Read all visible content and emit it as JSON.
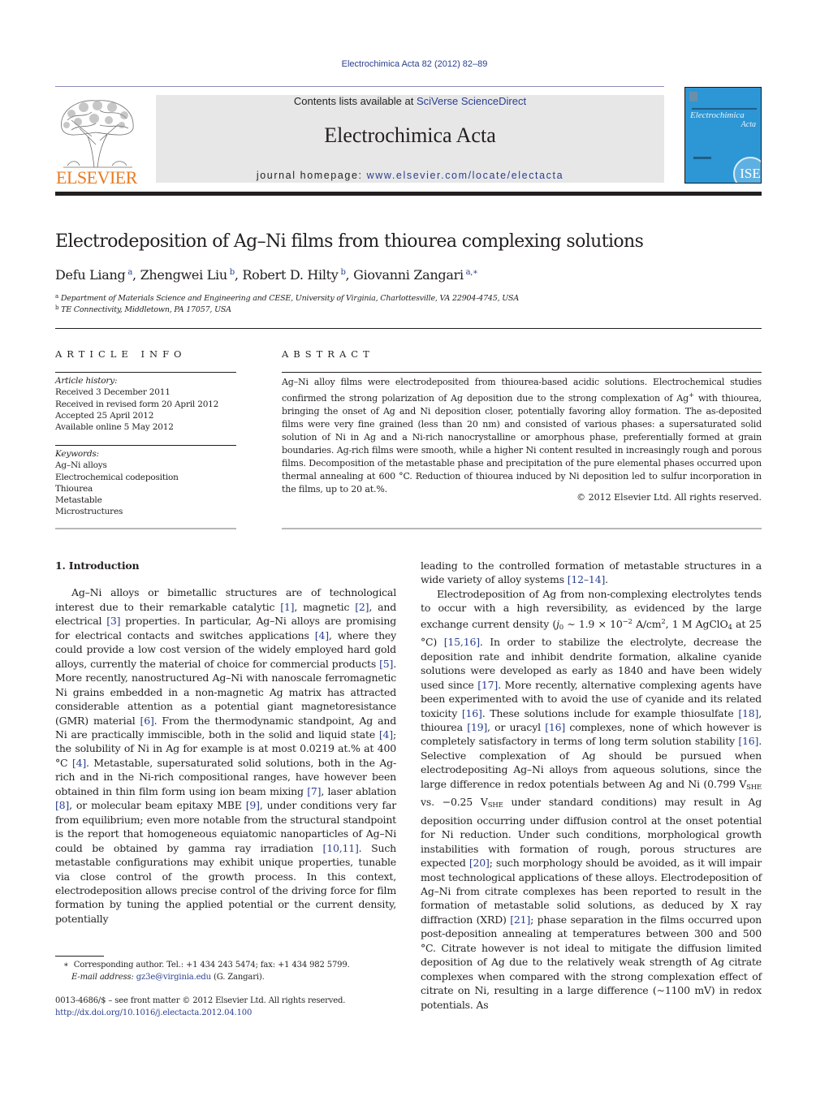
{
  "header": {
    "citation": "Electrochimica Acta 82 (2012) 82–89",
    "contents_prefix": "Contents lists available at ",
    "contents_link": "SciVerse ScienceDirect",
    "journal_name": "Electrochimica Acta",
    "homepage_prefix": "journal homepage: ",
    "homepage_link": "www.elsevier.com/locate/electacta",
    "publisher_logo_text": "ELSEVIER",
    "cover": {
      "title_line1": "Electrochimica",
      "title_line2": "Acta",
      "society_logo": "ISE",
      "background_color": "#2d96d4"
    }
  },
  "colors": {
    "link": "#2a3f8f",
    "elsevier_orange": "#e97a1f",
    "banner_grey": "#e7e7e8"
  },
  "article": {
    "title": "Electrodeposition of Ag–Ni films from thiourea complexing solutions",
    "authors": [
      {
        "name": "Defu Liang",
        "affil": "a",
        "sep": ", "
      },
      {
        "name": "Zhengwei Liu",
        "affil": "b",
        "sep": ", "
      },
      {
        "name": "Robert D. Hilty",
        "affil": "b",
        "sep": ", "
      },
      {
        "name": "Giovanni Zangari",
        "affil": "a,∗",
        "sep": ""
      }
    ],
    "affiliations": [
      {
        "key": "a",
        "text": "Department of Materials Science and Engineering and CESE, University of Virginia, Charlottesville, VA 22904-4745, USA"
      },
      {
        "key": "b",
        "text": "TE Connectivity, Middletown, PA 17057, USA"
      }
    ]
  },
  "article_info": {
    "heading": "ARTICLE INFO",
    "history_label": "Article history:",
    "history": [
      "Received 3 December 2011",
      "Received in revised form 20 April 2012",
      "Accepted 25 April 2012",
      "Available online 5 May 2012"
    ],
    "keywords_label": "Keywords:",
    "keywords": [
      "Ag–Ni alloys",
      "Electrochemical codeposition",
      "Thiourea",
      "Metastable",
      "Microstructures"
    ]
  },
  "abstract": {
    "heading": "ABSTRACT",
    "text_part1": "Ag–Ni alloy films were electrodeposited from thiourea-based acidic solutions. Electrochemical studies confirmed the strong polarization of Ag deposition due to the strong complexation of Ag",
    "text_sup": "+",
    "text_part2": " with thiourea, bringing the onset of Ag and Ni deposition closer, potentially favoring alloy formation. The as-deposited films were very fine grained (less than 20 nm) and consisted of various phases: a supersaturated solid solution of Ni in Ag and a Ni-rich nanocrystalline or amorphous phase, preferentially formed at grain boundaries. Ag-rich films were smooth, while a higher Ni content resulted in increasingly rough and porous films. Decomposition of the metastable phase and precipitation of the pure elemental phases occurred upon thermal annealing at 600 °C. Reduction of thiourea induced by Ni deposition led to sulfur incorporation in the films, up to 20 at.%.",
    "copyright": "© 2012 Elsevier Ltd. All rights reserved."
  },
  "introduction": {
    "heading": "1.  Introduction",
    "left_column": [
      {
        "t": "Ag–Ni alloys or bimetallic structures are of technological interest due to their remarkable catalytic "
      },
      {
        "r": "[1]"
      },
      {
        "t": ", magnetic "
      },
      {
        "r": "[2]"
      },
      {
        "t": ", and electrical "
      },
      {
        "r": "[3]"
      },
      {
        "t": " properties. In particular, Ag–Ni alloys are promising for electrical contacts and switches applications "
      },
      {
        "r": "[4]"
      },
      {
        "t": ", where they could provide a low cost version of the widely employed hard gold alloys, currently the material of choice for commercial products "
      },
      {
        "r": "[5]"
      },
      {
        "t": ". More recently, nanostructured Ag–Ni with nanoscale ferromagnetic Ni grains embedded in a non-magnetic Ag matrix has attracted considerable attention as a potential giant magnetoresistance (GMR) material "
      },
      {
        "r": "[6]"
      },
      {
        "t": ". From the thermodynamic standpoint, Ag and Ni are practically immiscible, both in the solid and liquid state "
      },
      {
        "r": "[4]"
      },
      {
        "t": "; the solubility of Ni in Ag for example is at most 0.0219 at.% at 400 °C "
      },
      {
        "r": "[4]"
      },
      {
        "t": ". Metastable, supersaturated solid solutions, both in the Ag-rich and in the Ni-rich compositional ranges, have however been obtained in thin film form using ion beam mixing "
      },
      {
        "r": "[7]"
      },
      {
        "t": ", laser ablation "
      },
      {
        "r": "[8]"
      },
      {
        "t": ", or molecular beam epitaxy MBE "
      },
      {
        "r": "[9]"
      },
      {
        "t": ", under conditions very far from equilibrium; even more notable from the structural standpoint is the report that homogeneous equiatomic nanoparticles of Ag–Ni could be obtained by gamma ray irradiation "
      },
      {
        "r": "[10,11]"
      },
      {
        "t": ". Such metastable configurations may exhibit unique properties, tunable via close control of the growth process. In this context, electrodeposition allows precise control of the driving force for film formation by tuning the applied potential or the current density, potentially"
      }
    ],
    "right_continuation": [
      {
        "t": "leading to the controlled formation of metastable structures in a wide variety of alloy systems "
      },
      {
        "r": "[12–14]"
      },
      {
        "t": "."
      }
    ],
    "right_paragraph": [
      {
        "t": "Electrodeposition of Ag from non-complexing electrolytes tends to occur with a high reversibility, as evidenced by the large exchange current density ("
      },
      {
        "i": "j"
      },
      {
        "sub": "0"
      },
      {
        "t": " ∼ 1.9 × 10"
      },
      {
        "sup": "−2"
      },
      {
        "t": " A/cm"
      },
      {
        "sup": "2"
      },
      {
        "t": ", 1 M AgClO"
      },
      {
        "sub": "4"
      },
      {
        "t": " at 25 °C) "
      },
      {
        "r": "[15,16]"
      },
      {
        "t": ". In order to stabilize the electrolyte, decrease the deposition rate and inhibit dendrite formation, alkaline cyanide solutions were developed as early as 1840 and have been widely used since "
      },
      {
        "r": "[17]"
      },
      {
        "t": ". More recently, alternative complexing agents have been experimented with to avoid the use of cyanide and its related toxicity "
      },
      {
        "r": "[16]"
      },
      {
        "t": ". These solutions include for example thiosulfate "
      },
      {
        "r": "[18]"
      },
      {
        "t": ", thiourea "
      },
      {
        "r": "[19]"
      },
      {
        "t": ", or uracyl "
      },
      {
        "r": "[16]"
      },
      {
        "t": " complexes, none of which however is completely satisfactory in terms of long term solution stability "
      },
      {
        "r": "[16]"
      },
      {
        "t": ". Selective complexation of Ag should be pursued when electrodepositing Ag–Ni alloys from aqueous solutions, since the large difference in redox potentials between Ag and Ni (0.799 V"
      },
      {
        "sub": "SHE"
      },
      {
        "t": " vs. −0.25 V"
      },
      {
        "sub": "SHE"
      },
      {
        "t": " under standard conditions) may result in Ag deposition occurring under diffusion control at the onset potential for Ni reduction. Under such conditions, morphological growth instabilities with formation of rough, porous structures are expected "
      },
      {
        "r": "[20]"
      },
      {
        "t": "; such morphology should be avoided, as it will impair most technological applications of these alloys. Electrodeposition of Ag–Ni from citrate complexes has been reported to result in the formation of metastable solid solutions, as deduced by X ray diffraction (XRD) "
      },
      {
        "r": "[21]"
      },
      {
        "t": "; phase separation in the films occurred upon post-deposition annealing at temperatures between 300 and 500 °C. Citrate however is not ideal to mitigate the diffusion limited deposition of Ag due to the relatively weak strength of Ag citrate complexes when compared with the strong complexation effect of citrate on Ni, resulting in a large difference (∼1100 mV) in redox potentials. As"
      }
    ]
  },
  "footnotes": {
    "corresponding_marker": "∗",
    "corresponding_text": "Corresponding author. Tel.: +1 434 243 5474; fax: +1 434 982 5799.",
    "email_label": "E-mail address:",
    "email": "gz3e@virginia.edu",
    "email_suffix": " (G. Zangari).",
    "front_matter": "0013-4686/$ – see front matter © 2012 Elsevier Ltd. All rights reserved.",
    "doi": "http://dx.doi.org/10.1016/j.electacta.2012.04.100"
  }
}
